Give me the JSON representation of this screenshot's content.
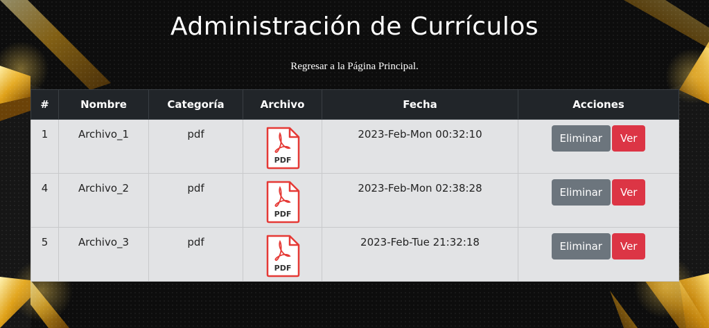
{
  "page": {
    "title": "Administración de Currículos",
    "back_link": "Regresar a la Página Principal."
  },
  "table": {
    "headers": {
      "num": "#",
      "nombre": "Nombre",
      "categoria": "Categoría",
      "archivo": "Archivo",
      "fecha": "Fecha",
      "acciones": "Acciones"
    },
    "rows": [
      {
        "num": "1",
        "nombre": "Archivo_1",
        "categoria": "pdf",
        "fecha": "2023-Feb-Mon 00:32:10",
        "icon": "pdf-file-icon",
        "icon_label": "PDF",
        "delete_label": "Eliminar",
        "view_label": "Ver"
      },
      {
        "num": "4",
        "nombre": "Archivo_2",
        "categoria": "pdf",
        "fecha": "2023-Feb-Mon 02:38:28",
        "icon": "pdf-file-icon",
        "icon_label": "PDF",
        "delete_label": "Eliminar",
        "view_label": "Ver"
      },
      {
        "num": "5",
        "nombre": "Archivo_3",
        "categoria": "pdf",
        "fecha": "2023-Feb-Tue 21:32:18",
        "icon": "pdf-file-icon",
        "icon_label": "PDF",
        "delete_label": "Eliminar",
        "view_label": "Ver"
      }
    ]
  },
  "colors": {
    "header_bg": "#212529",
    "row_bg": "#e2e3e5",
    "delete_button": "#6c757d",
    "view_button": "#dc3545",
    "pdf_red": "#e53935",
    "accent_gold": "#d4a017"
  }
}
